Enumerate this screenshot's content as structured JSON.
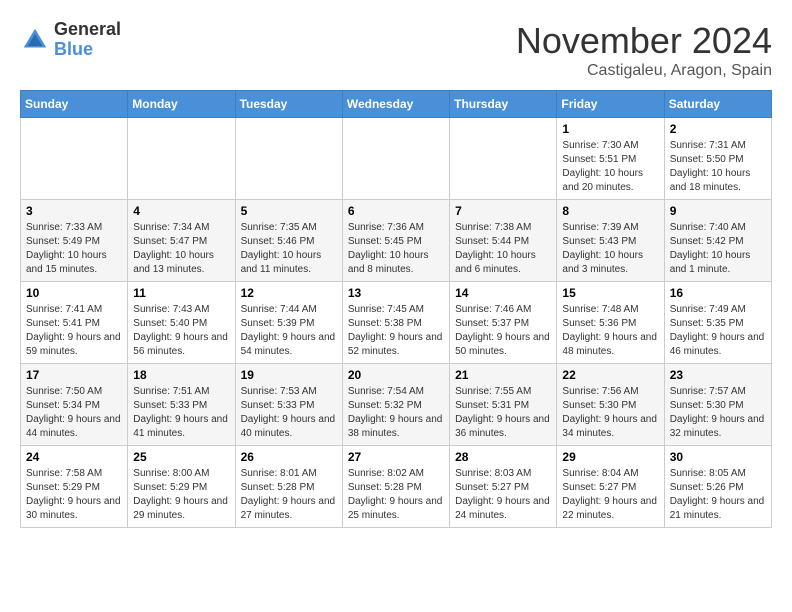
{
  "logo": {
    "general": "General",
    "blue": "Blue"
  },
  "title": {
    "month": "November 2024",
    "location": "Castigaleu, Aragon, Spain"
  },
  "weekdays": [
    "Sunday",
    "Monday",
    "Tuesday",
    "Wednesday",
    "Thursday",
    "Friday",
    "Saturday"
  ],
  "weeks": [
    [
      {
        "day": "",
        "sunrise": "",
        "sunset": "",
        "daylight": "",
        "empty": true
      },
      {
        "day": "",
        "sunrise": "",
        "sunset": "",
        "daylight": "",
        "empty": true
      },
      {
        "day": "",
        "sunrise": "",
        "sunset": "",
        "daylight": "",
        "empty": true
      },
      {
        "day": "",
        "sunrise": "",
        "sunset": "",
        "daylight": "",
        "empty": true
      },
      {
        "day": "",
        "sunrise": "",
        "sunset": "",
        "daylight": "",
        "empty": true
      },
      {
        "day": "1",
        "sunrise": "Sunrise: 7:30 AM",
        "sunset": "Sunset: 5:51 PM",
        "daylight": "Daylight: 10 hours and 20 minutes."
      },
      {
        "day": "2",
        "sunrise": "Sunrise: 7:31 AM",
        "sunset": "Sunset: 5:50 PM",
        "daylight": "Daylight: 10 hours and 18 minutes."
      }
    ],
    [
      {
        "day": "3",
        "sunrise": "Sunrise: 7:33 AM",
        "sunset": "Sunset: 5:49 PM",
        "daylight": "Daylight: 10 hours and 15 minutes."
      },
      {
        "day": "4",
        "sunrise": "Sunrise: 7:34 AM",
        "sunset": "Sunset: 5:47 PM",
        "daylight": "Daylight: 10 hours and 13 minutes."
      },
      {
        "day": "5",
        "sunrise": "Sunrise: 7:35 AM",
        "sunset": "Sunset: 5:46 PM",
        "daylight": "Daylight: 10 hours and 11 minutes."
      },
      {
        "day": "6",
        "sunrise": "Sunrise: 7:36 AM",
        "sunset": "Sunset: 5:45 PM",
        "daylight": "Daylight: 10 hours and 8 minutes."
      },
      {
        "day": "7",
        "sunrise": "Sunrise: 7:38 AM",
        "sunset": "Sunset: 5:44 PM",
        "daylight": "Daylight: 10 hours and 6 minutes."
      },
      {
        "day": "8",
        "sunrise": "Sunrise: 7:39 AM",
        "sunset": "Sunset: 5:43 PM",
        "daylight": "Daylight: 10 hours and 3 minutes."
      },
      {
        "day": "9",
        "sunrise": "Sunrise: 7:40 AM",
        "sunset": "Sunset: 5:42 PM",
        "daylight": "Daylight: 10 hours and 1 minute."
      }
    ],
    [
      {
        "day": "10",
        "sunrise": "Sunrise: 7:41 AM",
        "sunset": "Sunset: 5:41 PM",
        "daylight": "Daylight: 9 hours and 59 minutes."
      },
      {
        "day": "11",
        "sunrise": "Sunrise: 7:43 AM",
        "sunset": "Sunset: 5:40 PM",
        "daylight": "Daylight: 9 hours and 56 minutes."
      },
      {
        "day": "12",
        "sunrise": "Sunrise: 7:44 AM",
        "sunset": "Sunset: 5:39 PM",
        "daylight": "Daylight: 9 hours and 54 minutes."
      },
      {
        "day": "13",
        "sunrise": "Sunrise: 7:45 AM",
        "sunset": "Sunset: 5:38 PM",
        "daylight": "Daylight: 9 hours and 52 minutes."
      },
      {
        "day": "14",
        "sunrise": "Sunrise: 7:46 AM",
        "sunset": "Sunset: 5:37 PM",
        "daylight": "Daylight: 9 hours and 50 minutes."
      },
      {
        "day": "15",
        "sunrise": "Sunrise: 7:48 AM",
        "sunset": "Sunset: 5:36 PM",
        "daylight": "Daylight: 9 hours and 48 minutes."
      },
      {
        "day": "16",
        "sunrise": "Sunrise: 7:49 AM",
        "sunset": "Sunset: 5:35 PM",
        "daylight": "Daylight: 9 hours and 46 minutes."
      }
    ],
    [
      {
        "day": "17",
        "sunrise": "Sunrise: 7:50 AM",
        "sunset": "Sunset: 5:34 PM",
        "daylight": "Daylight: 9 hours and 44 minutes."
      },
      {
        "day": "18",
        "sunrise": "Sunrise: 7:51 AM",
        "sunset": "Sunset: 5:33 PM",
        "daylight": "Daylight: 9 hours and 41 minutes."
      },
      {
        "day": "19",
        "sunrise": "Sunrise: 7:53 AM",
        "sunset": "Sunset: 5:33 PM",
        "daylight": "Daylight: 9 hours and 40 minutes."
      },
      {
        "day": "20",
        "sunrise": "Sunrise: 7:54 AM",
        "sunset": "Sunset: 5:32 PM",
        "daylight": "Daylight: 9 hours and 38 minutes."
      },
      {
        "day": "21",
        "sunrise": "Sunrise: 7:55 AM",
        "sunset": "Sunset: 5:31 PM",
        "daylight": "Daylight: 9 hours and 36 minutes."
      },
      {
        "day": "22",
        "sunrise": "Sunrise: 7:56 AM",
        "sunset": "Sunset: 5:30 PM",
        "daylight": "Daylight: 9 hours and 34 minutes."
      },
      {
        "day": "23",
        "sunrise": "Sunrise: 7:57 AM",
        "sunset": "Sunset: 5:30 PM",
        "daylight": "Daylight: 9 hours and 32 minutes."
      }
    ],
    [
      {
        "day": "24",
        "sunrise": "Sunrise: 7:58 AM",
        "sunset": "Sunset: 5:29 PM",
        "daylight": "Daylight: 9 hours and 30 minutes."
      },
      {
        "day": "25",
        "sunrise": "Sunrise: 8:00 AM",
        "sunset": "Sunset: 5:29 PM",
        "daylight": "Daylight: 9 hours and 29 minutes."
      },
      {
        "day": "26",
        "sunrise": "Sunrise: 8:01 AM",
        "sunset": "Sunset: 5:28 PM",
        "daylight": "Daylight: 9 hours and 27 minutes."
      },
      {
        "day": "27",
        "sunrise": "Sunrise: 8:02 AM",
        "sunset": "Sunset: 5:28 PM",
        "daylight": "Daylight: 9 hours and 25 minutes."
      },
      {
        "day": "28",
        "sunrise": "Sunrise: 8:03 AM",
        "sunset": "Sunset: 5:27 PM",
        "daylight": "Daylight: 9 hours and 24 minutes."
      },
      {
        "day": "29",
        "sunrise": "Sunrise: 8:04 AM",
        "sunset": "Sunset: 5:27 PM",
        "daylight": "Daylight: 9 hours and 22 minutes."
      },
      {
        "day": "30",
        "sunrise": "Sunrise: 8:05 AM",
        "sunset": "Sunset: 5:26 PM",
        "daylight": "Daylight: 9 hours and 21 minutes."
      }
    ]
  ]
}
